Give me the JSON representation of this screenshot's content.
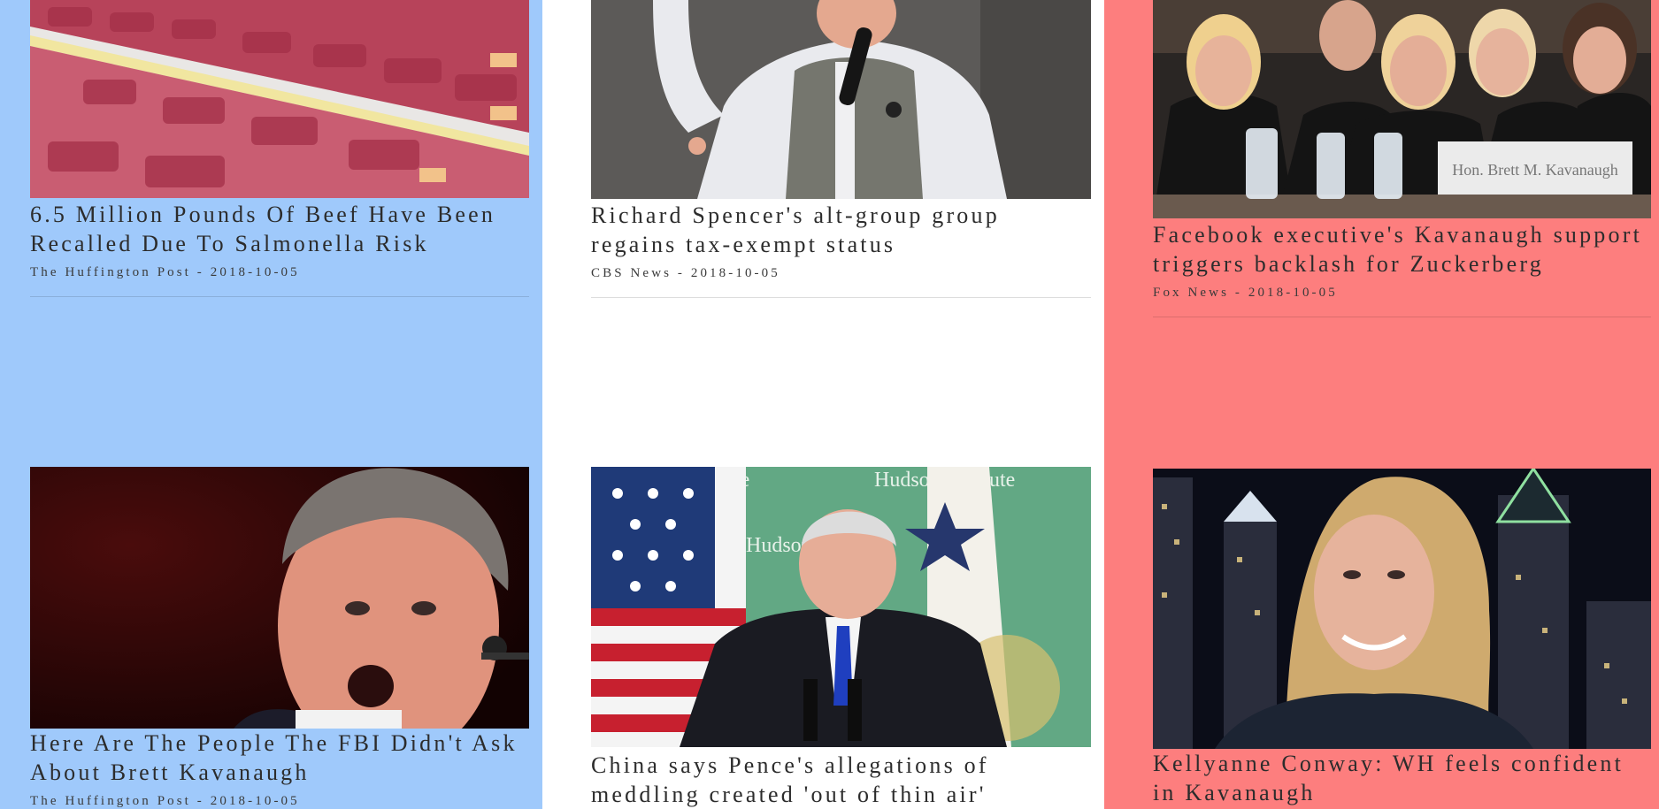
{
  "articles": [
    {
      "headline": "6.5 Million Pounds Of Beef Have Been Recalled Due To Salmonella Risk",
      "source": "The Huffington Post - 2018-10-05",
      "image": "meat-display-case"
    },
    {
      "headline": "Richard Spencer's alt-group group regains tax-exempt status",
      "source": "CBS News - 2018-10-05",
      "image": "man-speaking-into-microphone"
    },
    {
      "headline": "Facebook executive's Kavanaugh support triggers backlash for Zuckerberg",
      "source": "Fox News - 2018-10-05",
      "image": "hearing-audience",
      "placard": "Hon. Brett M. Kavanaugh"
    },
    {
      "headline": "Here Are The People The FBI Didn't Ask About Brett Kavanaugh",
      "source": "The Huffington Post - 2018-10-05",
      "image": "man-testifying"
    },
    {
      "headline": "China says Pence's allegations of meddling created 'out of thin air'",
      "source": "",
      "image": "pence-at-hudson-institute",
      "backdrop_text": "Hudson Institute"
    },
    {
      "headline": "Kellyanne Conway: WH feels confident in Kavanaugh",
      "source": "",
      "image": "woman-interview-city-night"
    }
  ],
  "colors": {
    "left_column": "#9fc9fb",
    "middle_column": "#ffffff",
    "right_column": "#fd7e7e",
    "headline_text": "#2c2c2c"
  }
}
